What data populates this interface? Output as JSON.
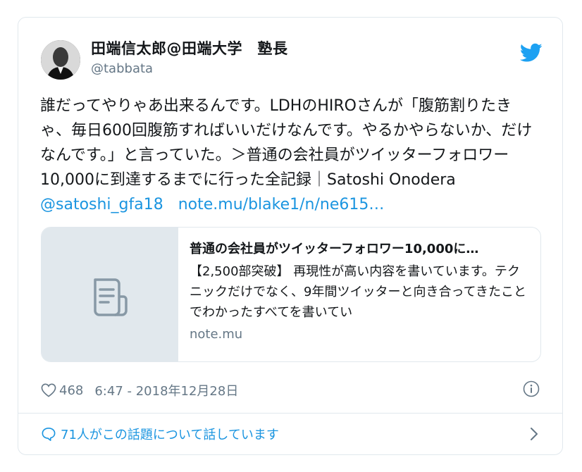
{
  "tweet": {
    "author_name": "田端信太郎@田端大学　塾長",
    "author_handle": "@tabbata",
    "body_text": "誰だってやりゃあ出来るんです。LDHのHIROさんが「腹筋割りたきゃ、毎日600回腹筋すればいいだけなんです。やるかやらないか、だけなんです。」と言っていた。＞普通の会社員がツイッターフォロワー10,000に到達するまでに行った全記録｜Satoshi Onodera ",
    "mention": "@satoshi_gfa18",
    "link": "note.mu/blake1/n/ne615…",
    "likes": "468",
    "timestamp": "6:47 - 2018年12月28日",
    "replies_text": "71人がこの話題について話しています"
  },
  "preview": {
    "title": "普通の会社員がツイッターフォロワー10,000に…",
    "description": "【2,500部突破】 再現性が高い内容を書いています。テクニックだけでなく、9年間ツイッターと向き合ってきたことでわかったすべてを書いてい",
    "domain": "note.mu",
    "icon": "document-icon"
  },
  "icons": {
    "twitter": "twitter-bird-icon",
    "heart": "heart-icon",
    "info": "info-icon",
    "reply": "speech-bubble-icon",
    "chevron": "chevron-right-icon"
  },
  "colors": {
    "link": "#1b95e0",
    "secondary_text": "#657786",
    "border": "#e1e8ed"
  }
}
